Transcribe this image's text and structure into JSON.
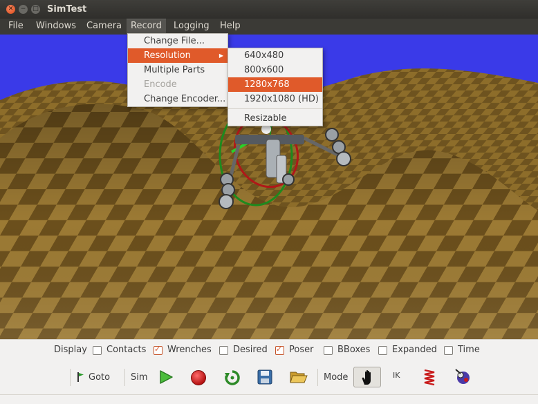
{
  "window": {
    "title": "SimTest",
    "controls": [
      "close-icon",
      "minimize-icon",
      "maximize-icon"
    ]
  },
  "menubar": {
    "items": [
      "File",
      "Windows",
      "Camera",
      "Record",
      "Logging",
      "Help"
    ],
    "active": "Record"
  },
  "record_menu": {
    "items": [
      {
        "label": "Change File...",
        "state": "normal"
      },
      {
        "label": "Resolution",
        "state": "highlighted",
        "submenu": true
      },
      {
        "label": "Multiple Parts",
        "state": "normal"
      },
      {
        "label": "Encode",
        "state": "disabled"
      },
      {
        "label": "Change Encoder...",
        "state": "normal"
      }
    ]
  },
  "resolution_menu": {
    "items": [
      "640x480",
      "800x600",
      "1280x768",
      "1920x1080 (HD)",
      "Resizable"
    ],
    "highlighted": "1280x768"
  },
  "display_bar": {
    "label": "Display",
    "options": [
      {
        "label": "Contacts",
        "checked": false
      },
      {
        "label": "Wrenches",
        "checked": true
      },
      {
        "label": "Desired",
        "checked": false
      },
      {
        "label": "Poser",
        "checked": true
      },
      {
        "label": "BBoxes",
        "checked": false
      },
      {
        "label": "Expanded",
        "checked": false
      },
      {
        "label": "Time",
        "checked": false
      }
    ]
  },
  "toolbar": {
    "goto_label": "Goto",
    "sim_label": "Sim",
    "mode_label": "Mode",
    "ik_label": "IK",
    "icons": [
      "flag-icon",
      "play-icon",
      "record-icon",
      "reset-icon",
      "save-icon",
      "open-folder-icon",
      "hand-icon",
      "spring-icon",
      "robot-icon"
    ]
  },
  "colors": {
    "menu_highlight": "#e05a2a",
    "sky": "#3a3ae8",
    "terrain_light": "#9c7a34",
    "terrain_dark": "#6b4f1c",
    "checkbox_check": "#d6552a",
    "record_button": "#d01818",
    "play_button": "#36a02c"
  }
}
